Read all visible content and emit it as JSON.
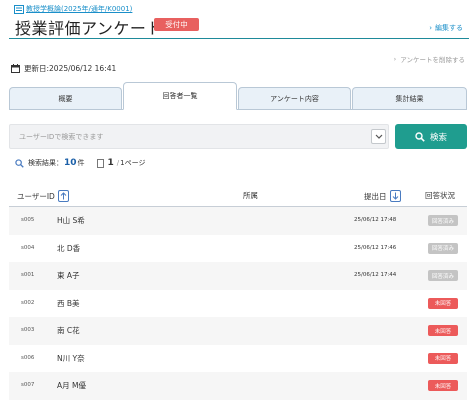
{
  "colors": {
    "accent": "#1f9d8f",
    "link": "#1a8fc9",
    "status_open": "#e8605f",
    "answered": "#c4c4c4",
    "unanswered": "#ec5a5a"
  },
  "breadcrumb": {
    "icon": "survey-list-icon",
    "text": "教授学概論(2025年/通年/K0001)"
  },
  "page": {
    "title": "授業評価アンケート",
    "status_badge": "受付中"
  },
  "header_actions": {
    "edit": "編集する",
    "delete": "アンケートを削除する"
  },
  "updated": {
    "icon": "calendar-icon",
    "text": "更新日:2025/06/12 16:41"
  },
  "tabs": [
    {
      "label": "概要",
      "active": false
    },
    {
      "label": "回答者一覧",
      "active": true
    },
    {
      "label": "アンケート内容",
      "active": false
    },
    {
      "label": "集計結果",
      "active": false
    }
  ],
  "search": {
    "placeholder": "ユーザーIDで検索できます",
    "button_label": "検索"
  },
  "results": {
    "label": "検索結果：",
    "count": "10",
    "count_unit": "件",
    "page_current": "1",
    "page_total": "1ページ"
  },
  "table": {
    "columns": {
      "user_id": "ユーザーID",
      "affiliation": "所属",
      "submitted": "提出日",
      "status": "回答状況"
    },
    "rows": [
      {
        "id": "s005",
        "name": "H山 S希",
        "date": "25/06/12 17:48",
        "status": "回答済み",
        "answered": true
      },
      {
        "id": "s004",
        "name": "北 D香",
        "date": "25/06/12 17:46",
        "status": "回答済み",
        "answered": true
      },
      {
        "id": "s001",
        "name": "東 A子",
        "date": "25/06/12 17:44",
        "status": "回答済み",
        "answered": true
      },
      {
        "id": "s002",
        "name": "西 B美",
        "date": "",
        "status": "未回答",
        "answered": false
      },
      {
        "id": "s003",
        "name": "南 C花",
        "date": "",
        "status": "未回答",
        "answered": false
      },
      {
        "id": "s006",
        "name": "N川 Y奈",
        "date": "",
        "status": "未回答",
        "answered": false
      },
      {
        "id": "s007",
        "name": "A月 M優",
        "date": "",
        "status": "未回答",
        "answered": false
      }
    ]
  }
}
